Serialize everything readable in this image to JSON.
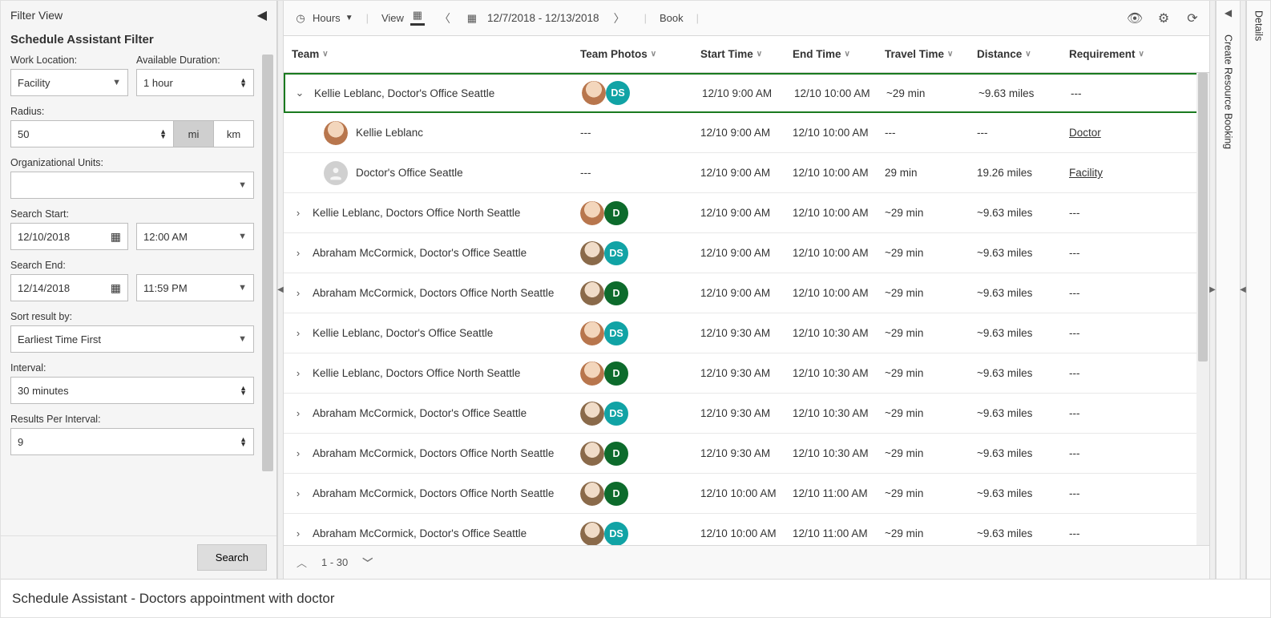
{
  "filter": {
    "panel_title": "Filter View",
    "subtitle": "Schedule Assistant Filter",
    "work_location_label": "Work Location:",
    "work_location_value": "Facility",
    "available_duration_label": "Available Duration:",
    "available_duration_value": "1 hour",
    "radius_label": "Radius:",
    "radius_value": "50",
    "unit_mi": "mi",
    "unit_km": "km",
    "org_units_label": "Organizational Units:",
    "org_units_value": "",
    "search_start_label": "Search Start:",
    "search_start_date": "12/10/2018",
    "search_start_time": "12:00 AM",
    "search_end_label": "Search End:",
    "search_end_date": "12/14/2018",
    "search_end_time": "11:59 PM",
    "sort_label": "Sort result by:",
    "sort_value": "Earliest Time First",
    "interval_label": "Interval:",
    "interval_value": "30 minutes",
    "rpi_label": "Results Per Interval:",
    "rpi_value": "9",
    "search_button": "Search"
  },
  "toolbar": {
    "hours_label": "Hours",
    "view_label": "View",
    "date_range": "12/7/2018 - 12/13/2018",
    "book_label": "Book"
  },
  "columns": {
    "team": "Team",
    "photos": "Team Photos",
    "start": "Start Time",
    "end": "End Time",
    "travel": "Travel Time",
    "distance": "Distance",
    "requirement": "Requirement"
  },
  "rows": [
    {
      "expand": "open",
      "team": "Kellie Leblanc, Doctor's Office Seattle",
      "avatar": "k",
      "badge": "DS",
      "badgeClass": "ds",
      "start": "12/10 9:00 AM",
      "end": "12/10 10:00 AM",
      "travel": "~29 min",
      "distance": "~9.63 miles",
      "req": "---",
      "selected": true
    },
    {
      "sub": true,
      "team": "Kellie Leblanc",
      "avatar": "k",
      "photos": "---",
      "start": "12/10 9:00 AM",
      "end": "12/10 10:00 AM",
      "travel": "---",
      "distance": "---",
      "req": "Doctor",
      "reqLink": true
    },
    {
      "sub": true,
      "team": "Doctor's Office Seattle",
      "avatar": "g",
      "photos": "---",
      "start": "12/10 9:00 AM",
      "end": "12/10 10:00 AM",
      "travel": "29 min",
      "distance": "19.26 miles",
      "req": "Facility",
      "reqLink": true
    },
    {
      "expand": "closed",
      "team": "Kellie Leblanc, Doctors Office North Seattle",
      "avatar": "k",
      "badge": "D",
      "badgeClass": "d",
      "start": "12/10 9:00 AM",
      "end": "12/10 10:00 AM",
      "travel": "~29 min",
      "distance": "~9.63 miles",
      "req": "---"
    },
    {
      "expand": "closed",
      "team": "Abraham McCormick, Doctor's Office Seattle",
      "avatar": "a",
      "badge": "DS",
      "badgeClass": "ds",
      "start": "12/10 9:00 AM",
      "end": "12/10 10:00 AM",
      "travel": "~29 min",
      "distance": "~9.63 miles",
      "req": "---"
    },
    {
      "expand": "closed",
      "team": "Abraham McCormick, Doctors Office North Seattle",
      "avatar": "a",
      "badge": "D",
      "badgeClass": "d",
      "start": "12/10 9:00 AM",
      "end": "12/10 10:00 AM",
      "travel": "~29 min",
      "distance": "~9.63 miles",
      "req": "---"
    },
    {
      "expand": "closed",
      "team": "Kellie Leblanc, Doctor's Office Seattle",
      "avatar": "k",
      "badge": "DS",
      "badgeClass": "ds",
      "start": "12/10 9:30 AM",
      "end": "12/10 10:30 AM",
      "travel": "~29 min",
      "distance": "~9.63 miles",
      "req": "---"
    },
    {
      "expand": "closed",
      "team": "Kellie Leblanc, Doctors Office North Seattle",
      "avatar": "k",
      "badge": "D",
      "badgeClass": "d",
      "start": "12/10 9:30 AM",
      "end": "12/10 10:30 AM",
      "travel": "~29 min",
      "distance": "~9.63 miles",
      "req": "---"
    },
    {
      "expand": "closed",
      "team": "Abraham McCormick, Doctor's Office Seattle",
      "avatar": "a",
      "badge": "DS",
      "badgeClass": "ds",
      "start": "12/10 9:30 AM",
      "end": "12/10 10:30 AM",
      "travel": "~29 min",
      "distance": "~9.63 miles",
      "req": "---"
    },
    {
      "expand": "closed",
      "team": "Abraham McCormick, Doctors Office North Seattle",
      "avatar": "a",
      "badge": "D",
      "badgeClass": "d",
      "start": "12/10 9:30 AM",
      "end": "12/10 10:30 AM",
      "travel": "~29 min",
      "distance": "~9.63 miles",
      "req": "---"
    },
    {
      "expand": "closed",
      "team": "Abraham McCormick, Doctors Office North Seattle",
      "avatar": "a",
      "badge": "D",
      "badgeClass": "d",
      "start": "12/10 10:00 AM",
      "end": "12/10 11:00 AM",
      "travel": "~29 min",
      "distance": "~9.63 miles",
      "req": "---"
    },
    {
      "expand": "closed",
      "team": "Abraham McCormick, Doctor's Office Seattle",
      "avatar": "a",
      "badge": "DS",
      "badgeClass": "ds",
      "start": "12/10 10:00 AM",
      "end": "12/10 11:00 AM",
      "travel": "~29 min",
      "distance": "~9.63 miles",
      "req": "---"
    }
  ],
  "grid_footer": {
    "range": "1 - 30"
  },
  "right_tabs": {
    "create": "Create Resource Booking",
    "details": "Details"
  },
  "bottom_title": "Schedule Assistant - Doctors appointment with doctor"
}
